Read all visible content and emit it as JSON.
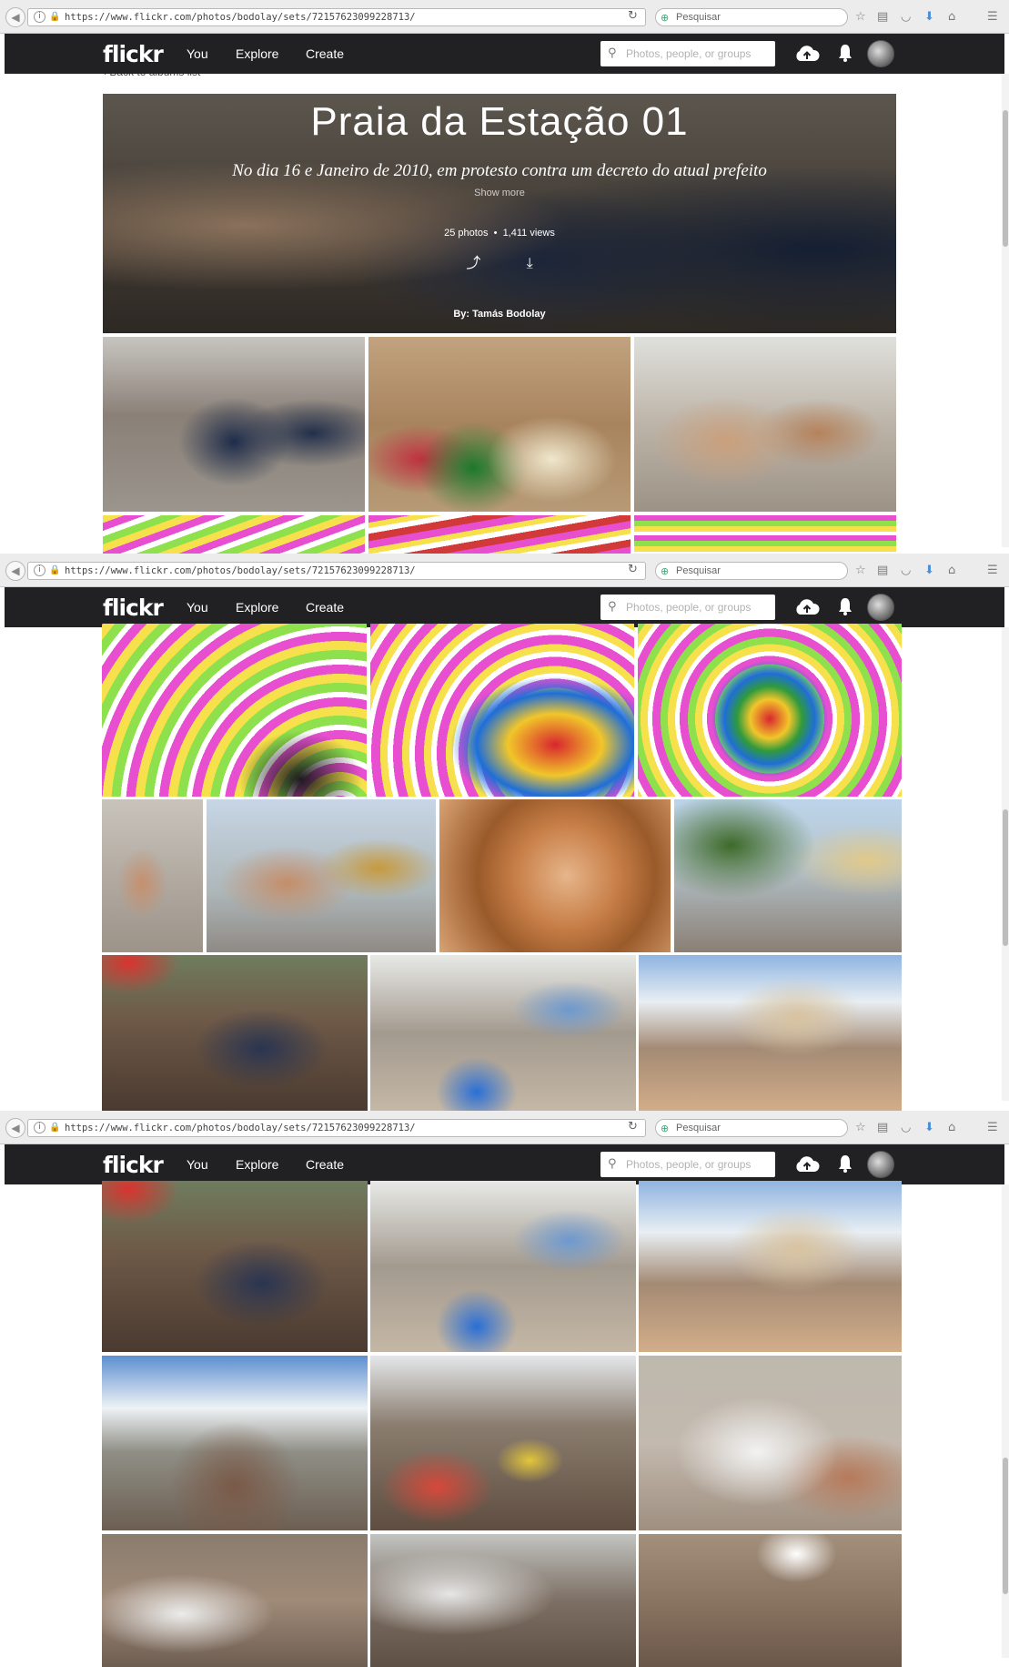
{
  "browser": {
    "url": "https://www.flickr.com/photos/bodolay/sets/72157623099228713/",
    "search_placeholder": "Pesquisar"
  },
  "nav": {
    "logo": "flickr",
    "items": [
      "You",
      "Explore",
      "Create"
    ],
    "search_placeholder": "Photos, people, or groups"
  },
  "album": {
    "back_link": "Back to albums list",
    "title": "Praia da Estação 01",
    "description": "No dia 16 e Janeiro de 2010, em protesto contra um decreto do atual prefeito",
    "show_more": "Show more",
    "photo_count": "25 photos",
    "views": "1,411 views",
    "author": "By: Tamás Bodolay"
  },
  "icons": {
    "back": "arrow-left-icon",
    "share": "share-icon",
    "download": "download-icon",
    "upload": "cloud-upload-icon",
    "notifications": "bell-icon",
    "search": "search-icon",
    "bookmark": "star-icon",
    "reader": "reader-icon",
    "pocket": "pocket-icon",
    "downloads": "download-arrow-icon",
    "home": "home-icon",
    "menu": "menu-icon"
  },
  "colors": {
    "navbar": "#212124",
    "chrome": "#ececec"
  }
}
